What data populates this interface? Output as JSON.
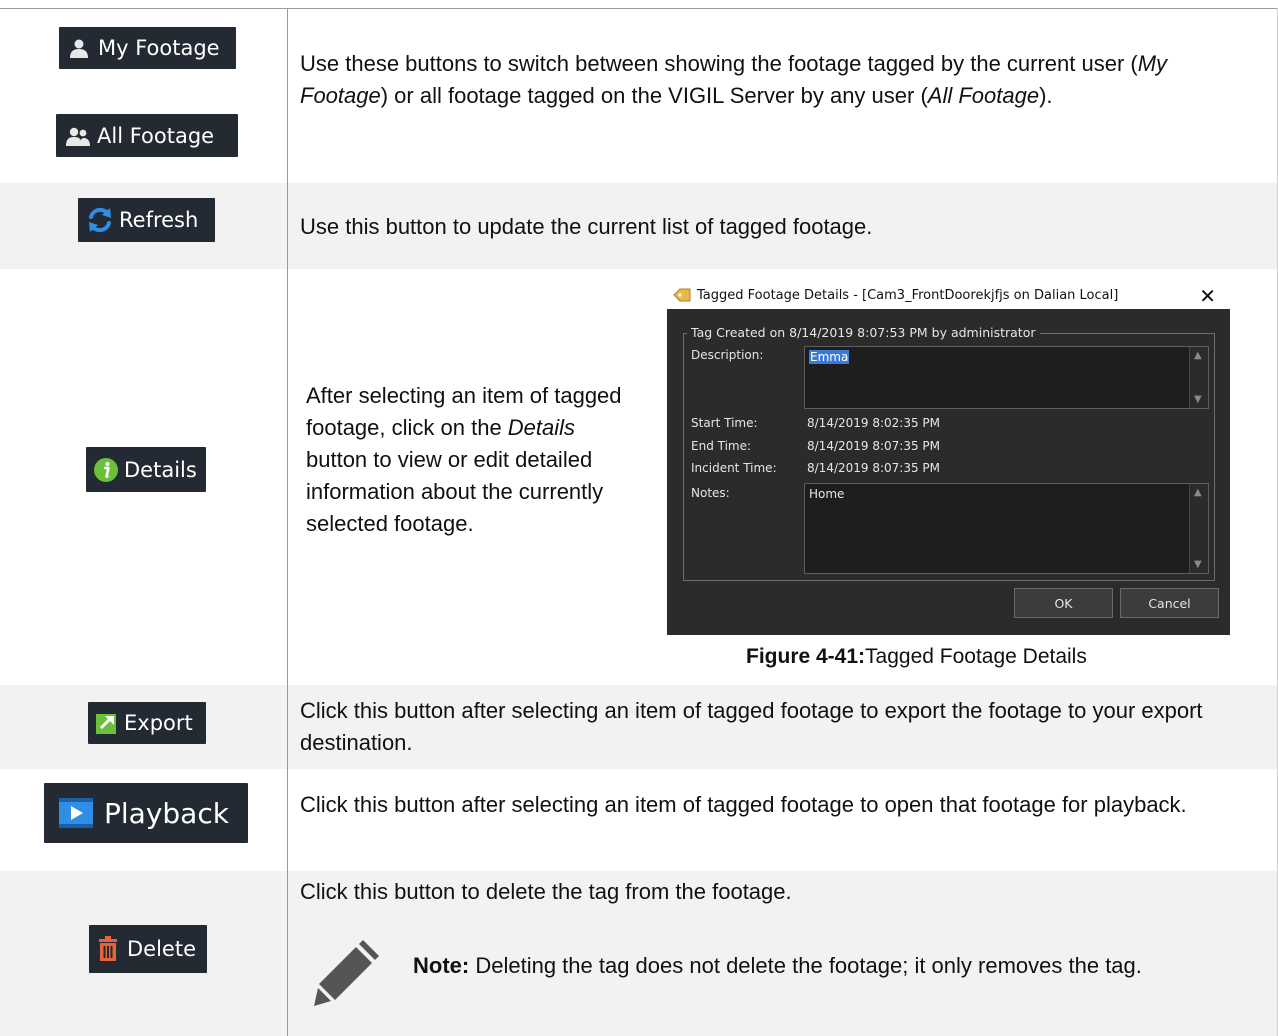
{
  "rows": [
    {
      "buttons": [
        {
          "label": "My Footage",
          "icon": "user-icon"
        },
        {
          "label": "All Footage",
          "icon": "users-icon"
        }
      ],
      "desc_a": "Use these buttons to switch between showing the footage tagged by the current user (",
      "desc_i1": "My Footage",
      "desc_b": ") or all footage tagged on the VIGIL Server by any user (",
      "desc_i2": "All Footage",
      "desc_c": ")."
    },
    {
      "button": {
        "label": "Refresh",
        "icon": "refresh-icon"
      },
      "desc": "Use this button to update the current list of tagged footage."
    },
    {
      "button": {
        "label": "Details",
        "icon": "info-icon"
      },
      "desc_a": "After selecting an item of tagged footage, click on the ",
      "desc_i": "Details",
      "desc_b": " button to view or edit detailed information about the currently selected footage."
    },
    {
      "button": {
        "label": "Export",
        "icon": "export-icon"
      },
      "desc": "Click this button after selecting an item of tagged footage to export the footage to your export destination."
    },
    {
      "button": {
        "label": "Playback",
        "icon": "playback-icon"
      },
      "desc": "Click this button after selecting an item of tagged footage to open that footage for playback."
    },
    {
      "button": {
        "label": "Delete",
        "icon": "trash-icon"
      },
      "desc": "Click this button to delete the tag from the footage.",
      "note_label": "Note:",
      "note_text": " Deleting the tag does not delete the footage; it only removes the tag."
    }
  ],
  "dialog": {
    "title": "Tagged Footage Details - [Cam3_FrontDoorekjfjs on Dalian Local]",
    "close": "✕",
    "group_legend": "Tag Created on 8/14/2019 8:07:53 PM by administrator",
    "description_label": "Description:",
    "description_value": "Emma",
    "start_label": "Start Time:",
    "start_value": "8/14/2019 8:02:35 PM",
    "end_label": "End Time:",
    "end_value": "8/14/2019 8:07:35 PM",
    "incident_label": "Incident Time:",
    "incident_value": "8/14/2019 8:07:35 PM",
    "notes_label": "Notes:",
    "notes_value": "Home",
    "ok": "OK",
    "cancel": "Cancel"
  },
  "figure": {
    "label": "Figure 4-41:",
    "caption": "Tagged Footage Details"
  },
  "colors": {
    "button_bg": "#232a33",
    "dialog_bg": "#2b2b2b",
    "row_shade": "#f2f2f2"
  }
}
